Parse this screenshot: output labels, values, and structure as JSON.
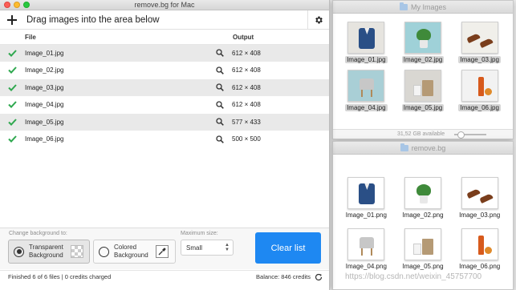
{
  "app": {
    "title": "remove.bg for Mac",
    "toolbar": {
      "add_icon": "plus-icon",
      "drag_prompt": "Drag images into the area below",
      "settings_icon": "gear-icon"
    },
    "table": {
      "headers": {
        "file": "File",
        "output": "Output"
      },
      "rows": [
        {
          "file": "Image_01.jpg",
          "output": "612 × 408"
        },
        {
          "file": "Image_02.jpg",
          "output": "612 × 408"
        },
        {
          "file": "Image_03.jpg",
          "output": "612 × 408"
        },
        {
          "file": "Image_04.jpg",
          "output": "612 × 408"
        },
        {
          "file": "Image_05.jpg",
          "output": "577 × 433"
        },
        {
          "file": "Image_06.jpg",
          "output": "500 × 500"
        }
      ]
    },
    "bottom": {
      "change_bg_label": "Change background to:",
      "transparent_label": "Transparent Background",
      "colored_label": "Colored Background",
      "max_size_label": "Maximum size:",
      "size_value": "Small",
      "clear_button": "Clear list"
    },
    "status": {
      "left": "Finished 6 of 6 files | 0 credits charged",
      "balance": "Balance: 846 credits"
    },
    "colors": {
      "accent": "#1e88f2",
      "check": "#2fa84f"
    }
  },
  "finder_images": {
    "title": "My Images",
    "files": [
      "Image_01.jpg",
      "Image_02.jpg",
      "Image_03.jpg",
      "Image_04.jpg",
      "Image_05.jpg",
      "Image_06.jpg"
    ],
    "status": "31,52 GB available"
  },
  "finder_removebg": {
    "title": "remove.bg",
    "files": [
      "Image_01.png",
      "Image_02.png",
      "Image_03.png",
      "Image_04.png",
      "Image_05.png",
      "Image_06.png"
    ]
  },
  "watermark": "https://blog.csdn.net/weixin_45757700"
}
